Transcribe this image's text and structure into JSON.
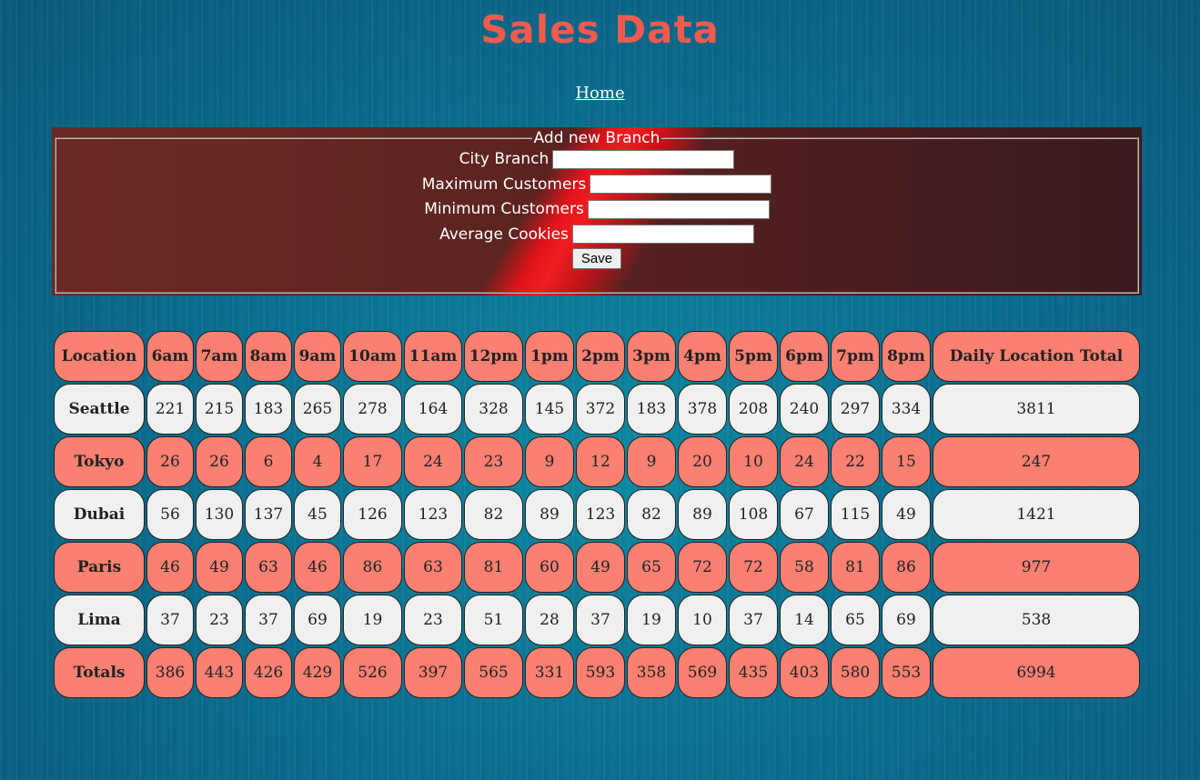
{
  "page": {
    "title": "Sales Data",
    "nav_home": "Home"
  },
  "form": {
    "legend": "Add new Branch",
    "city_label": "City Branch",
    "max_label": "Maximum Customers",
    "min_label": "Minimum Customers",
    "avg_label": "Average Cookies",
    "save_label": "Save"
  },
  "table": {
    "headers": [
      "Location",
      "6am",
      "7am",
      "8am",
      "9am",
      "10am",
      "11am",
      "12pm",
      "1pm",
      "2pm",
      "3pm",
      "4pm",
      "5pm",
      "6pm",
      "7pm",
      "8pm",
      "Daily Location Total"
    ],
    "rows": [
      {
        "location": "Seattle",
        "values": [
          "221",
          "215",
          "183",
          "265",
          "278",
          "164",
          "328",
          "145",
          "372",
          "183",
          "378",
          "208",
          "240",
          "297",
          "334"
        ],
        "total": "3811"
      },
      {
        "location": "Tokyo",
        "values": [
          "26",
          "26",
          "6",
          "4",
          "17",
          "24",
          "23",
          "9",
          "12",
          "9",
          "20",
          "10",
          "24",
          "22",
          "15"
        ],
        "total": "247"
      },
      {
        "location": "Dubai",
        "values": [
          "56",
          "130",
          "137",
          "45",
          "126",
          "123",
          "82",
          "89",
          "123",
          "82",
          "89",
          "108",
          "67",
          "115",
          "49"
        ],
        "total": "1421"
      },
      {
        "location": "Paris",
        "values": [
          "46",
          "49",
          "63",
          "46",
          "86",
          "63",
          "81",
          "60",
          "49",
          "65",
          "72",
          "72",
          "58",
          "81",
          "86"
        ],
        "total": "977"
      },
      {
        "location": "Lima",
        "values": [
          "37",
          "23",
          "37",
          "69",
          "19",
          "23",
          "51",
          "28",
          "37",
          "19",
          "10",
          "37",
          "14",
          "65",
          "69"
        ],
        "total": "538"
      }
    ],
    "totals": {
      "label": "Totals",
      "values": [
        "386",
        "443",
        "426",
        "429",
        "526",
        "397",
        "565",
        "331",
        "593",
        "358",
        "569",
        "435",
        "403",
        "580",
        "553"
      ],
      "total": "6994"
    }
  },
  "colors": {
    "title": "#f05a4f",
    "salmon_row": "#fa8072",
    "light_row": "#f0f0ef"
  }
}
